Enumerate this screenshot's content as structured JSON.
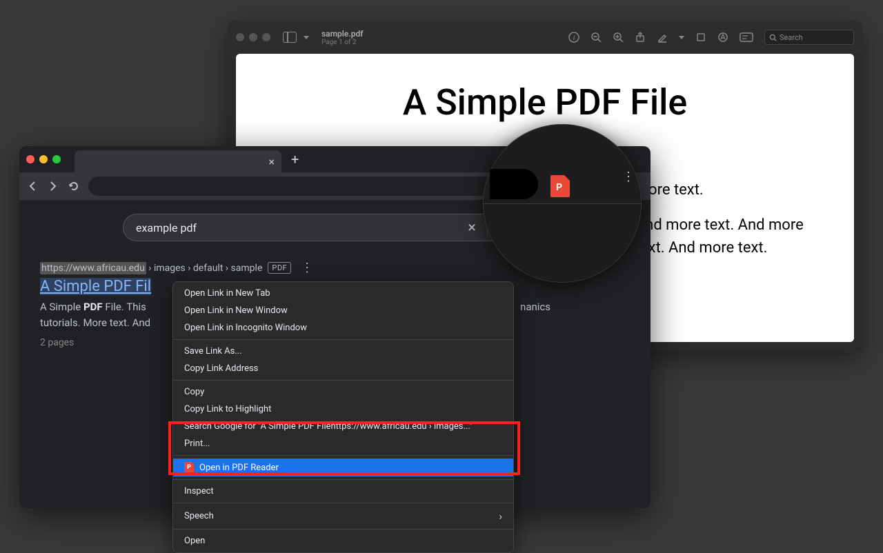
{
  "pdf_viewer": {
    "filename": "sample.pdf",
    "page_info": "Page 1 of 2",
    "search_placeholder": "Search",
    "document": {
      "title": "A Simple PDF File",
      "para1": "More text. And more text.",
      "para2": "And more text. And more text. And more text. And more text. And more text."
    }
  },
  "chrome": {
    "search_query": "example pdf",
    "result": {
      "url_host": "https://www.africau.edu",
      "url_path": " › images › default › sample",
      "badge": "PDF",
      "title": "A Simple PDF Fil",
      "desc_prefix": "A Simple ",
      "desc_bold": "PDF",
      "desc_rest": " File. This",
      "desc_line2": "tutorials. More text. And",
      "desc_right": "nanics",
      "pages": "2 pages"
    }
  },
  "context_menu": {
    "items": [
      "Open Link in New Tab",
      "Open Link in New Window",
      "Open Link in Incognito Window"
    ],
    "group2": [
      "Save Link As...",
      "Copy Link Address"
    ],
    "group3": [
      "Copy",
      "Copy Link to Highlight",
      "Search Google for \"A Simple PDF Filehttps://www.africau.edu › images...\"",
      "Print..."
    ],
    "pdf_reader": "Open in PDF Reader",
    "inspect": "Inspect",
    "speech": "Speech",
    "open": "Open"
  },
  "lens": {
    "ext_letter": "P"
  }
}
